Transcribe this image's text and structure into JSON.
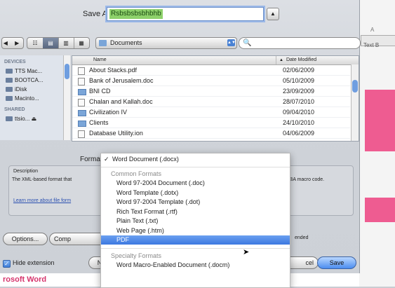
{
  "save_as": {
    "label": "Save As:",
    "value": "Rsbsbsbsbhbhb"
  },
  "toolbar": {
    "nav": "◀ ▶",
    "views": [
      "☷",
      "▤",
      "▥",
      "▦"
    ],
    "location": "Documents",
    "search_placeholder": ""
  },
  "sidebar": {
    "devices_header": "DEVICES",
    "devices": [
      "TTS Mac...",
      "BOOTCA...",
      "iDisk",
      "Macinto..."
    ],
    "shared_header": "SHARED",
    "shared": [
      "ttsio... ⏏"
    ]
  },
  "file_list": {
    "col_name": "Name",
    "col_date": "Date Modified",
    "rows": [
      {
        "name": "About Stacks.pdf",
        "date": "02/06/2009",
        "type": "file"
      },
      {
        "name": "Bank of Jerusalem.doc",
        "date": "05/10/2009",
        "type": "file"
      },
      {
        "name": "BNI CD",
        "date": "23/09/2009",
        "type": "folder"
      },
      {
        "name": "Chalan and Kallah.doc",
        "date": "28/07/2010",
        "type": "file"
      },
      {
        "name": "Civilization IV",
        "date": "09/04/2010",
        "type": "folder"
      },
      {
        "name": "Clients",
        "date": "24/10/2010",
        "type": "folder"
      },
      {
        "name": "Database Utility.ion",
        "date": "04/06/2009",
        "type": "file"
      }
    ]
  },
  "format": {
    "label": "Format",
    "description_header": "Description",
    "description": "The XML-based format that",
    "description_tail": "VBA macro code.",
    "learn_more": "Learn more about file form"
  },
  "menu": {
    "selected_check": "✓",
    "items": [
      {
        "label": "Word Document (.docx)",
        "kind": "checked"
      },
      {
        "label": "Common Formats",
        "kind": "header"
      },
      {
        "label": "Word 97-2004 Document (.doc)",
        "kind": "item"
      },
      {
        "label": "Word Template (.dotx)",
        "kind": "item"
      },
      {
        "label": "Word 97-2004 Template (.dot)",
        "kind": "item"
      },
      {
        "label": "Rich Text Format (.rtf)",
        "kind": "item"
      },
      {
        "label": "Plain Text (.txt)",
        "kind": "item"
      },
      {
        "label": "Web Page (.htm)",
        "kind": "item"
      },
      {
        "label": "PDF",
        "kind": "selected"
      },
      {
        "label": "Specialty Formats",
        "kind": "header"
      },
      {
        "label": "Word Macro-Enabled Document (.docm)",
        "kind": "item"
      }
    ]
  },
  "buttons": {
    "options": "Options...",
    "compatibility": "Comp",
    "new_folder": "N",
    "cancel": "cel",
    "save": "Save",
    "hide_extension": "Hide extension",
    "ended": "ended"
  },
  "background": {
    "bottom_text": "rosoft Word",
    "right_text": "Text B",
    "right_tab": "A"
  }
}
